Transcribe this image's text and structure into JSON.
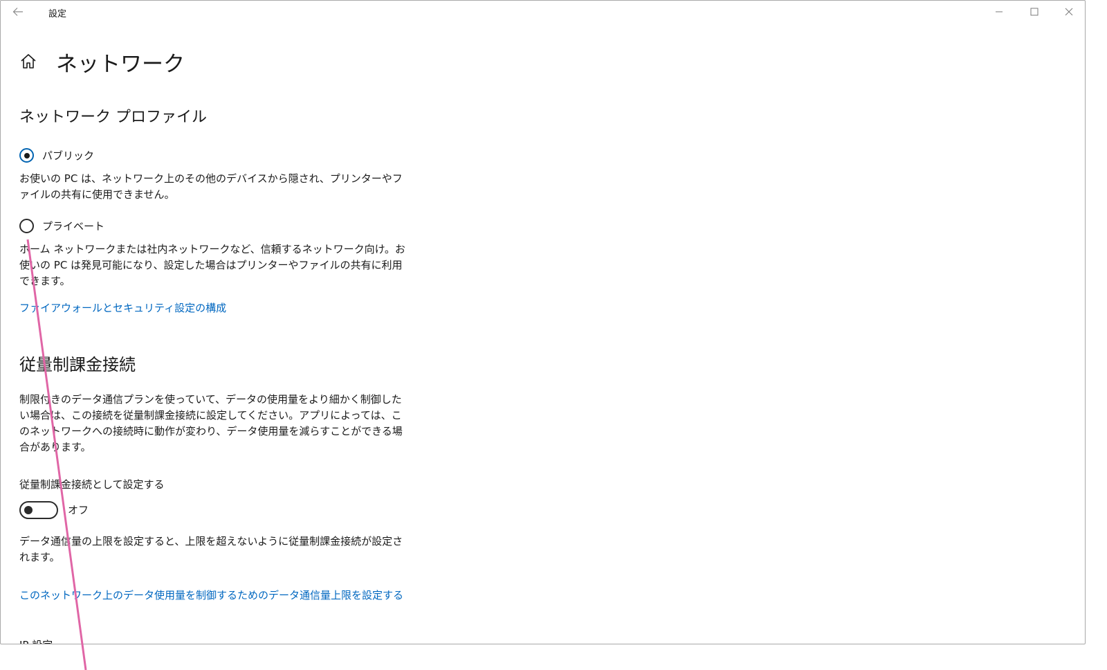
{
  "window": {
    "title": "設定",
    "accent_color": "#0067c0",
    "annotation_color": "#e066a6"
  },
  "header": {
    "page_title": "ネットワーク"
  },
  "network_profile": {
    "title": "ネットワーク プロファイル",
    "options": [
      {
        "label": "パブリック",
        "selected": true,
        "description": "お使いの PC は、ネットワーク上のその他のデバイスから隠され、プリンターやファイルの共有に使用できません。"
      },
      {
        "label": "プライベート",
        "selected": false,
        "description": "ホーム ネットワークまたは社内ネットワークなど、信頼するネットワーク向け。お使いの PC は発見可能になり、設定した場合はプリンターやファイルの共有に利用できます。"
      }
    ],
    "firewall_link": "ファイアウォールとセキュリティ設定の構成"
  },
  "metered": {
    "title": "従量制課金接続",
    "description": "制限付きのデータ通信プランを使っていて、データの使用量をより細かく制御したい場合は、この接続を従量制課金接続に設定してください。アプリによっては、このネットワークへの接続時に動作が変わり、データ使用量を減らすことができる場合があります。",
    "toggle_label": "従量制課金接続として設定する",
    "toggle_state": "オフ",
    "toggle_on": false,
    "limit_note": "データ通信量の上限を設定すると、上限を超えないように従量制課金接続が設定されます。",
    "limit_link": "このネットワーク上のデータ使用量を制御するためのデータ通信量上限を設定する"
  },
  "cut_off_section": "IP 設定"
}
